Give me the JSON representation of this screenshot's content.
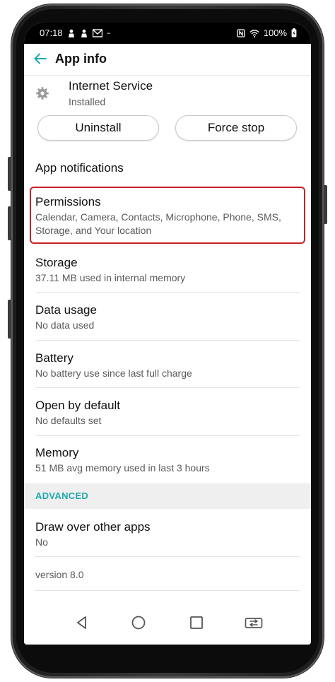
{
  "status_bar": {
    "time": "07:18",
    "battery": "100%"
  },
  "app_bar": {
    "title": "App info"
  },
  "app": {
    "name": "Internet Service",
    "status": "Installed"
  },
  "buttons": {
    "uninstall": "Uninstall",
    "force_stop": "Force stop"
  },
  "rows": {
    "notifications": {
      "title": "App notifications"
    },
    "permissions": {
      "title": "Permissions",
      "line1": "Calendar, Camera, Contacts, Microphone, Phone, SMS,",
      "line2": "Storage, and Your location"
    },
    "storage": {
      "title": "Storage",
      "subtitle": "37.11 MB used in internal memory"
    },
    "data_usage": {
      "title": "Data usage",
      "subtitle": "No data used"
    },
    "battery": {
      "title": "Battery",
      "subtitle": "No battery use since last full charge"
    },
    "open_by_default": {
      "title": "Open by default",
      "subtitle": "No defaults set"
    },
    "memory": {
      "title": "Memory",
      "subtitle": "51 MB avg memory used in last 3 hours"
    }
  },
  "advanced": {
    "header": "ADVANCED",
    "draw_over": {
      "title": "Draw over other apps",
      "subtitle": "No"
    }
  },
  "version": "version 8.0",
  "colors": {
    "accent": "#1fa8b0",
    "highlight_border": "#c8202a"
  },
  "icons": {
    "back": "arrow-left-icon",
    "app": "gear-icon",
    "nav_back": "triangle-back-icon",
    "nav_home": "circle-home-icon",
    "nav_recents": "square-recents-icon",
    "nav_switch": "switch-apps-icon"
  }
}
